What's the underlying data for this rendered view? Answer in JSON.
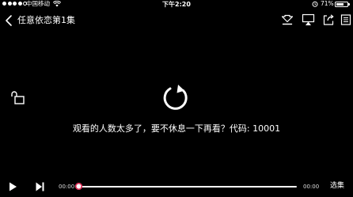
{
  "status_bar": {
    "carrier": "中国移动",
    "time": "下午2:20",
    "battery_percent": "71%",
    "battery_level": 0.71,
    "signal_bars": 4
  },
  "top_bar": {
    "title": "任意依恋第1集",
    "icons": [
      "download-icon",
      "airplay-icon",
      "share-icon",
      "more-icon"
    ]
  },
  "player": {
    "error_message": "观看的人数太多了，要不休息一下再看？代码: 10001",
    "current_time": "00:00",
    "total_time": "00:00",
    "progress": 0,
    "episodes_label": "选集",
    "accent_color": "#e0204d"
  }
}
